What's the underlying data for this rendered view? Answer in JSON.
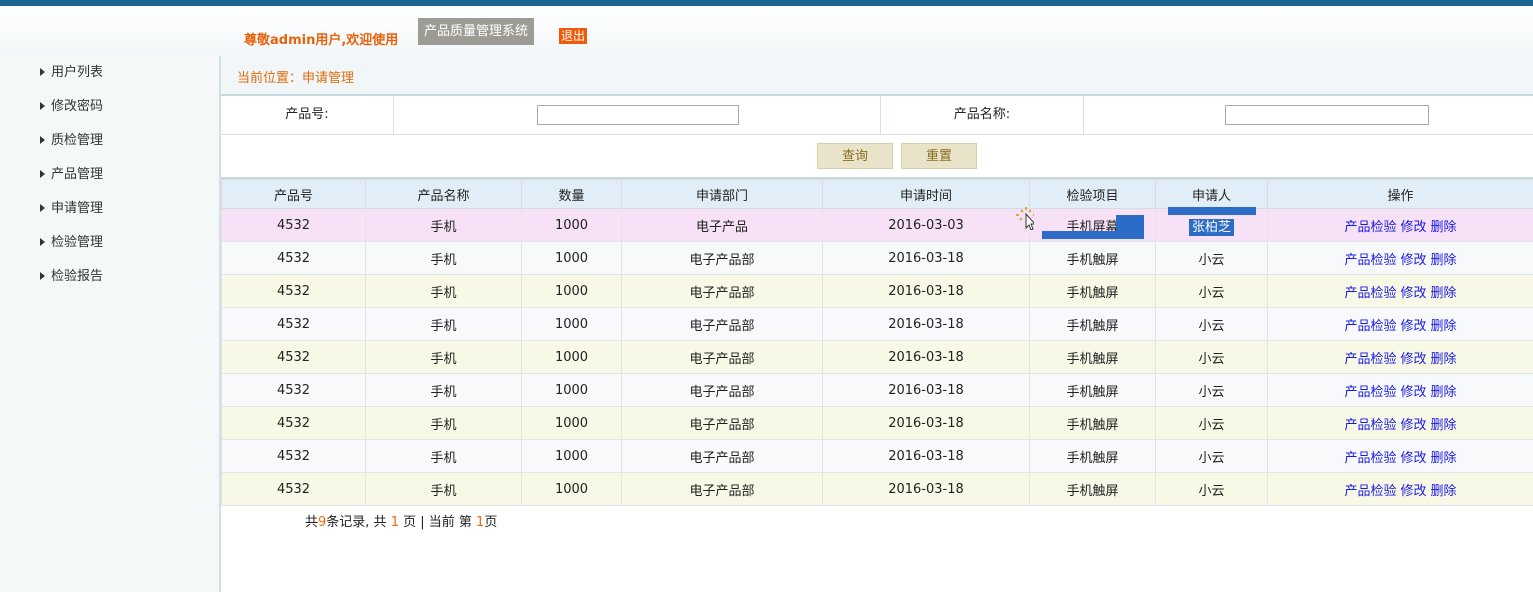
{
  "header": {
    "welcome": "尊敬admin用户,欢迎使用",
    "system_name": "产品质量管理系统",
    "logout_label": "退出"
  },
  "sidebar": {
    "items": [
      {
        "label": "用户列表"
      },
      {
        "label": "修改密码"
      },
      {
        "label": "质检管理"
      },
      {
        "label": "产品管理"
      },
      {
        "label": "申请管理"
      },
      {
        "label": "检验管理"
      },
      {
        "label": "检验报告"
      }
    ]
  },
  "breadcrumb": "当前位置：申请管理",
  "search": {
    "product_no_label": "产品号:",
    "product_no_value": "",
    "product_name_label": "产品名称:",
    "product_name_value": "",
    "query_label": "查询",
    "reset_label": "重置"
  },
  "table": {
    "headers": [
      "产品号",
      "产品名称",
      "数量",
      "申请部门",
      "申请时间",
      "检验项目",
      "申请人",
      "操作"
    ],
    "rows": [
      {
        "no": "4532",
        "name": "手机",
        "qty": "1000",
        "dept": "电子产品",
        "time": "2016-03-03",
        "item": "手机屏幕",
        "applicant": "张柏芝",
        "ops": [
          "产品检验",
          "修改",
          "删除"
        ]
      },
      {
        "no": "4532",
        "name": "手机",
        "qty": "1000",
        "dept": "电子产品部",
        "time": "2016-03-18",
        "item": "手机触屏",
        "applicant": "小云",
        "ops": [
          "产品检验",
          "修改",
          "删除"
        ]
      },
      {
        "no": "4532",
        "name": "手机",
        "qty": "1000",
        "dept": "电子产品部",
        "time": "2016-03-18",
        "item": "手机触屏",
        "applicant": "小云",
        "ops": [
          "产品检验",
          "修改",
          "删除"
        ]
      },
      {
        "no": "4532",
        "name": "手机",
        "qty": "1000",
        "dept": "电子产品部",
        "time": "2016-03-18",
        "item": "手机触屏",
        "applicant": "小云",
        "ops": [
          "产品检验",
          "修改",
          "删除"
        ]
      },
      {
        "no": "4532",
        "name": "手机",
        "qty": "1000",
        "dept": "电子产品部",
        "time": "2016-03-18",
        "item": "手机触屏",
        "applicant": "小云",
        "ops": [
          "产品检验",
          "修改",
          "删除"
        ]
      },
      {
        "no": "4532",
        "name": "手机",
        "qty": "1000",
        "dept": "电子产品部",
        "time": "2016-03-18",
        "item": "手机触屏",
        "applicant": "小云",
        "ops": [
          "产品检验",
          "修改",
          "删除"
        ]
      },
      {
        "no": "4532",
        "name": "手机",
        "qty": "1000",
        "dept": "电子产品部",
        "time": "2016-03-18",
        "item": "手机触屏",
        "applicant": "小云",
        "ops": [
          "产品检验",
          "修改",
          "删除"
        ]
      },
      {
        "no": "4532",
        "name": "手机",
        "qty": "1000",
        "dept": "电子产品部",
        "time": "2016-03-18",
        "item": "手机触屏",
        "applicant": "小云",
        "ops": [
          "产品检验",
          "修改",
          "删除"
        ]
      },
      {
        "no": "4532",
        "name": "手机",
        "qty": "1000",
        "dept": "电子产品部",
        "time": "2016-03-18",
        "item": "手机触屏",
        "applicant": "小云",
        "ops": [
          "产品检验",
          "修改",
          "删除"
        ]
      }
    ]
  },
  "pager": {
    "prefix": "共",
    "total": "9",
    "records_suffix": "条记录, 共",
    "pages": "1",
    "pages_suffix": "页 | 当前 第",
    "current": "1",
    "current_suffix": "页"
  },
  "colors": {
    "accent_orange": "#e8620c",
    "link_blue": "#1a1ae6",
    "top_bar": "#1c6691",
    "selection": "#2c6bc6"
  },
  "icons": [
    "triangle-bullet-icon",
    "loading-cursor-icon"
  ]
}
